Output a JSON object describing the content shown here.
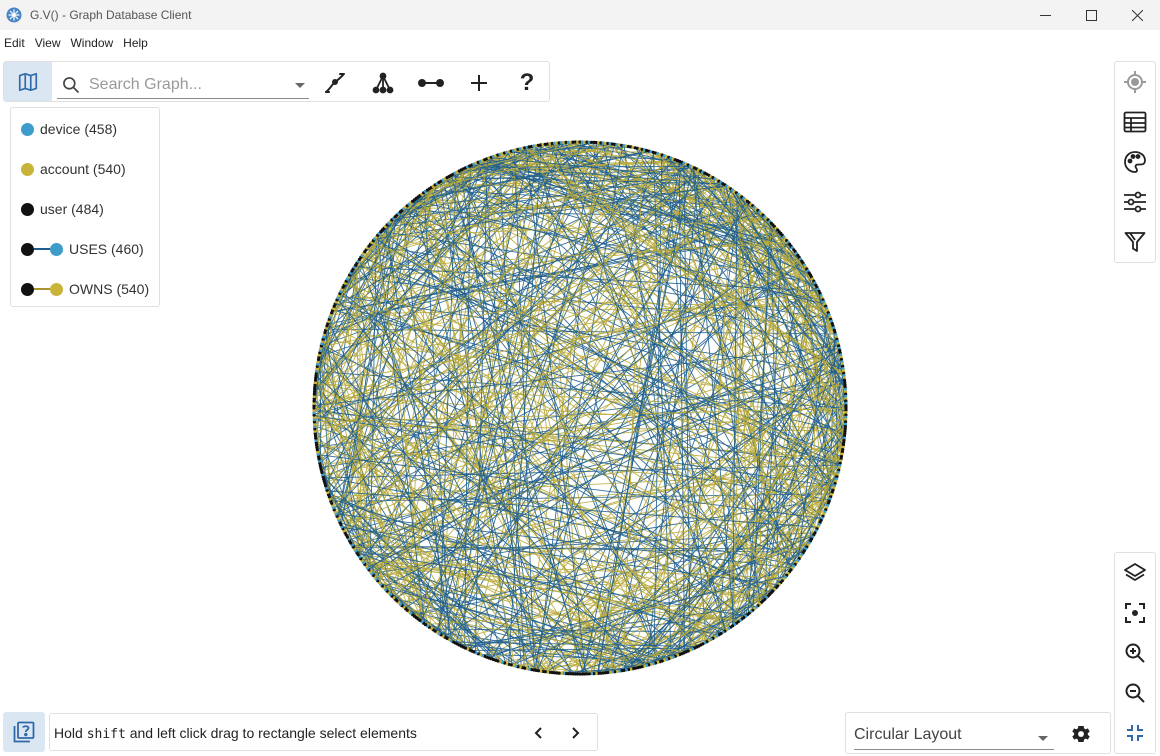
{
  "window": {
    "title": "G.V() - Graph Database Client",
    "controls": [
      "minimize",
      "maximize",
      "close"
    ]
  },
  "menu": {
    "items": [
      "Edit",
      "View",
      "Window",
      "Help"
    ]
  },
  "toolbar": {
    "search_placeholder": "Search Graph...",
    "icons": [
      "map-icon",
      "search-icon",
      "path-icon",
      "tree-icon",
      "edge-icon",
      "plus-icon",
      "help-icon"
    ],
    "help_label": "?"
  },
  "legend": {
    "items": [
      {
        "label": "device (458)",
        "kind": "vertex",
        "color": "#3d9cc9"
      },
      {
        "label": "account (540)",
        "kind": "vertex",
        "color": "#c9b43a"
      },
      {
        "label": "user (484)",
        "kind": "vertex",
        "color": "#111111"
      },
      {
        "label": "USES (460)",
        "kind": "edge",
        "from_color": "#111111",
        "to_color": "#3d9cc9",
        "edge_color": "#1f5f8f"
      },
      {
        "label": "OWNS (540)",
        "kind": "edge",
        "from_color": "#111111",
        "to_color": "#c9b43a",
        "edge_color": "#a89530"
      }
    ]
  },
  "graph": {
    "layout": "circular",
    "edge_colors": [
      "#1f5f8f",
      "#b7a93a"
    ]
  },
  "right_panel_top": {
    "icons": [
      "locate-icon",
      "table-icon",
      "palette-icon",
      "sliders-icon",
      "filter-icon"
    ]
  },
  "right_panel_bottom": {
    "icons": [
      "layers-icon",
      "focus-icon",
      "zoom-in-icon",
      "zoom-out-icon",
      "collapse-icon"
    ]
  },
  "status": {
    "text_before": "Hold ",
    "key": "shift",
    "text_after": " and left click drag to rectangle select elements"
  },
  "layout_select": {
    "value": "Circular Layout"
  },
  "colors": {
    "accent": "#1f5f8f",
    "active_bg": "#dbe6f3"
  }
}
